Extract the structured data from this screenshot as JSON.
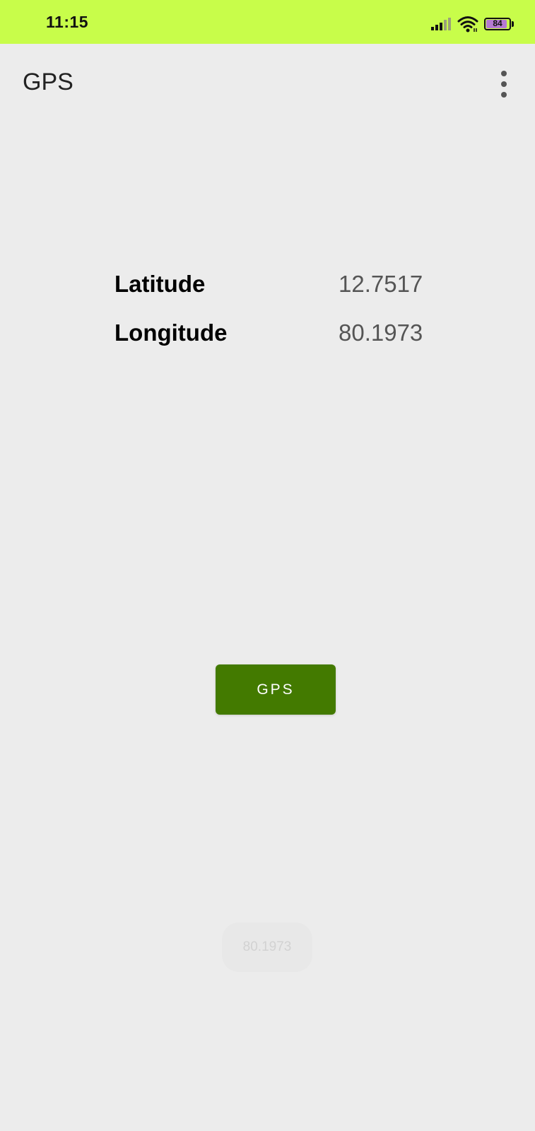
{
  "status_bar": {
    "time": "11:15",
    "battery_level": "84",
    "icons": [
      "signal-icon",
      "wifi-icon",
      "battery-icon"
    ],
    "background_color": "#c8fd4a"
  },
  "app_bar": {
    "title": "GPS",
    "menu_icon": "more-vert-icon"
  },
  "coordinates": {
    "latitude_label": "Latitude",
    "latitude_value": "12.7517",
    "longitude_label": "Longitude",
    "longitude_value": "80.1973"
  },
  "gps_button": {
    "label": "GPS",
    "color": "#437a00"
  },
  "toast": {
    "text": "80.1973"
  }
}
